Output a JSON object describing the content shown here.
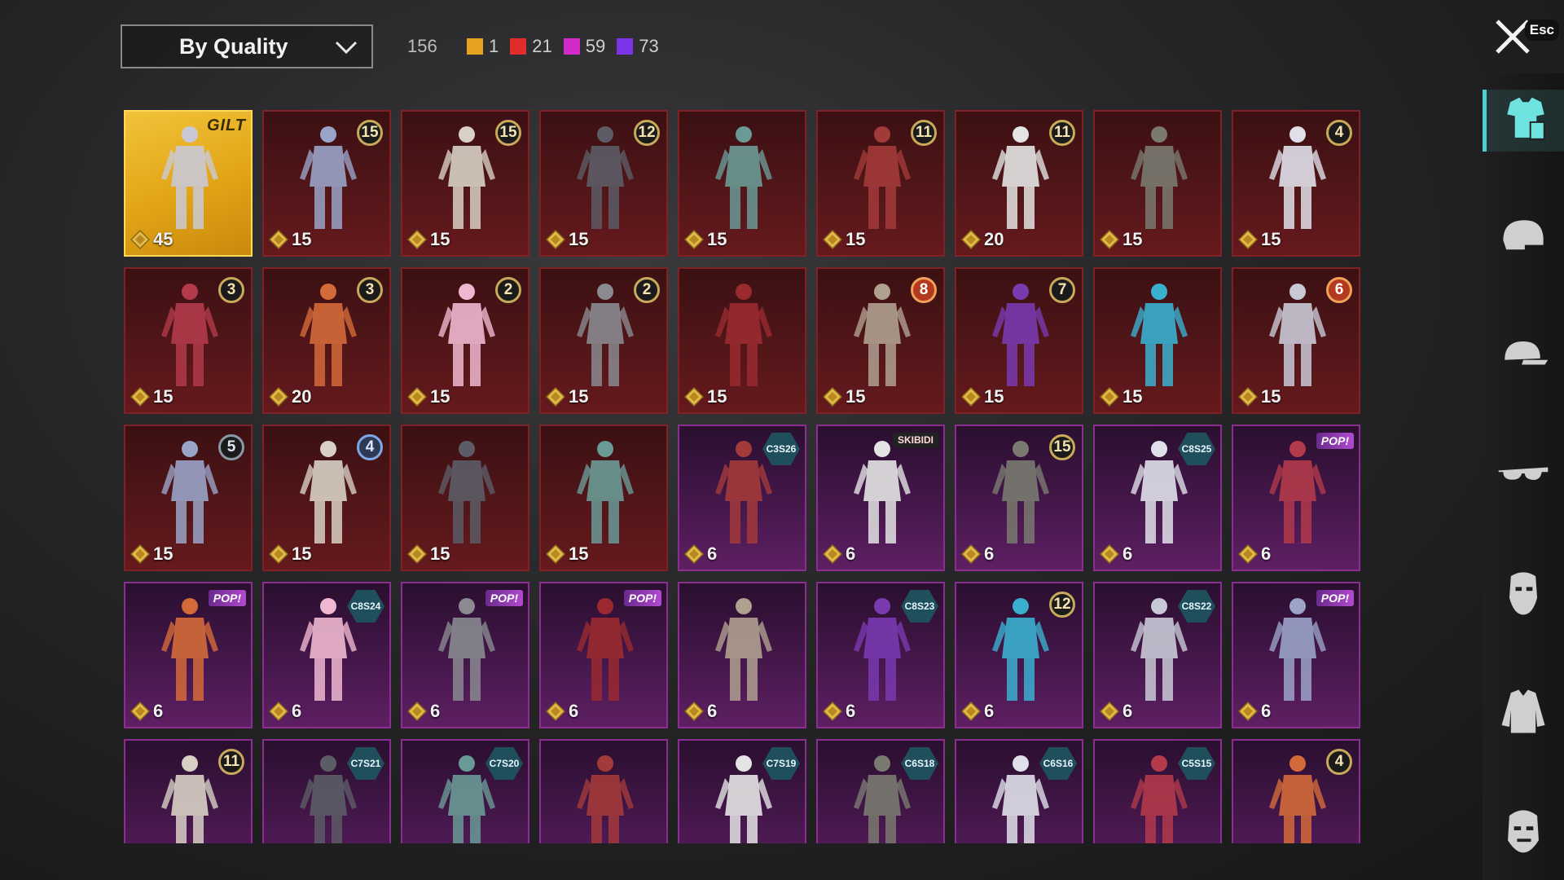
{
  "header": {
    "sort_label": "By Quality",
    "total": "156",
    "legend": [
      {
        "color": "#e6a21e",
        "count": "1"
      },
      {
        "color": "#e22b2b",
        "count": "21"
      },
      {
        "color": "#d22bc8",
        "count": "59"
      },
      {
        "color": "#7b35e6",
        "count": "73"
      }
    ],
    "close_label": "Esc"
  },
  "sidebar": {
    "items": [
      {
        "icon": "outfit-icon",
        "active": true
      },
      {
        "icon": "helmet-icon",
        "active": false
      },
      {
        "icon": "cap-icon",
        "active": false
      },
      {
        "icon": "glasses-icon",
        "active": false
      },
      {
        "icon": "mask-icon",
        "active": false
      },
      {
        "icon": "jacket-icon",
        "active": false
      },
      {
        "icon": "face-icon",
        "active": false
      }
    ]
  },
  "items": [
    {
      "tier": "gold",
      "cost": "45",
      "badge": {
        "type": "logo",
        "text": "GILT"
      }
    },
    {
      "tier": "red",
      "cost": "15",
      "badge": {
        "type": "num",
        "text": "15"
      }
    },
    {
      "tier": "red",
      "cost": "15",
      "badge": {
        "type": "num",
        "text": "15"
      }
    },
    {
      "tier": "red",
      "cost": "15",
      "badge": {
        "type": "num",
        "text": "12"
      }
    },
    {
      "tier": "red",
      "cost": "15",
      "badge": null
    },
    {
      "tier": "red",
      "cost": "15",
      "badge": {
        "type": "num",
        "text": "11"
      }
    },
    {
      "tier": "red",
      "cost": "20",
      "badge": {
        "type": "num",
        "text": "11"
      }
    },
    {
      "tier": "red",
      "cost": "15",
      "badge": null
    },
    {
      "tier": "red",
      "cost": "15",
      "badge": {
        "type": "num",
        "text": "4"
      }
    },
    {
      "tier": "red",
      "cost": "15",
      "badge": {
        "type": "num",
        "text": "3"
      }
    },
    {
      "tier": "red",
      "cost": "20",
      "badge": {
        "type": "num",
        "text": "3"
      }
    },
    {
      "tier": "red",
      "cost": "15",
      "badge": {
        "type": "num",
        "text": "2"
      }
    },
    {
      "tier": "red",
      "cost": "15",
      "badge": {
        "type": "num",
        "text": "2"
      }
    },
    {
      "tier": "red",
      "cost": "15",
      "badge": null
    },
    {
      "tier": "red",
      "cost": "15",
      "badge": {
        "type": "num",
        "text": "8",
        "style": "orange"
      }
    },
    {
      "tier": "red",
      "cost": "15",
      "badge": {
        "type": "num",
        "text": "7"
      }
    },
    {
      "tier": "red",
      "cost": "15",
      "badge": null
    },
    {
      "tier": "red",
      "cost": "15",
      "badge": {
        "type": "num",
        "text": "6",
        "style": "orange"
      }
    },
    {
      "tier": "red",
      "cost": "15",
      "badge": {
        "type": "num",
        "text": "5",
        "style": "grey"
      }
    },
    {
      "tier": "red",
      "cost": "15",
      "badge": {
        "type": "num",
        "text": "4",
        "style": "blue"
      }
    },
    {
      "tier": "red",
      "cost": "15",
      "badge": null
    },
    {
      "tier": "red",
      "cost": "15",
      "badge": null
    },
    {
      "tier": "purple",
      "cost": "6",
      "badge": {
        "type": "season",
        "text": "C3S26"
      }
    },
    {
      "tier": "purple",
      "cost": "6",
      "badge": {
        "type": "tag-dark",
        "text": "SKIBIDI"
      }
    },
    {
      "tier": "purple",
      "cost": "6",
      "badge": {
        "type": "num",
        "text": "15"
      }
    },
    {
      "tier": "purple",
      "cost": "6",
      "badge": {
        "type": "season",
        "text": "C8S25"
      }
    },
    {
      "tier": "purple",
      "cost": "6",
      "badge": {
        "type": "tag",
        "text": "POP!"
      }
    },
    {
      "tier": "purple",
      "cost": "6",
      "badge": {
        "type": "tag",
        "text": "POP!"
      }
    },
    {
      "tier": "purple",
      "cost": "6",
      "badge": {
        "type": "season",
        "text": "C8S24"
      }
    },
    {
      "tier": "purple",
      "cost": "6",
      "badge": {
        "type": "tag",
        "text": "POP!"
      }
    },
    {
      "tier": "purple",
      "cost": "6",
      "badge": {
        "type": "tag",
        "text": "POP!"
      }
    },
    {
      "tier": "purple",
      "cost": "6",
      "badge": null
    },
    {
      "tier": "purple",
      "cost": "6",
      "badge": {
        "type": "season",
        "text": "C8S23"
      }
    },
    {
      "tier": "purple",
      "cost": "6",
      "badge": {
        "type": "num",
        "text": "12"
      }
    },
    {
      "tier": "purple",
      "cost": "6",
      "badge": {
        "type": "season",
        "text": "C8S22"
      }
    },
    {
      "tier": "purple",
      "cost": "6",
      "badge": {
        "type": "tag",
        "text": "POP!"
      }
    },
    {
      "tier": "purple",
      "cost": "",
      "badge": {
        "type": "num",
        "text": "11"
      }
    },
    {
      "tier": "purple",
      "cost": "",
      "badge": {
        "type": "season",
        "text": "C7S21"
      }
    },
    {
      "tier": "purple",
      "cost": "",
      "badge": {
        "type": "season",
        "text": "C7S20"
      }
    },
    {
      "tier": "purple",
      "cost": "",
      "badge": null
    },
    {
      "tier": "purple",
      "cost": "",
      "badge": {
        "type": "season",
        "text": "C7S19"
      }
    },
    {
      "tier": "purple",
      "cost": "",
      "badge": {
        "type": "season",
        "text": "C6S18"
      }
    },
    {
      "tier": "purple",
      "cost": "",
      "badge": {
        "type": "season",
        "text": "C6S16"
      }
    },
    {
      "tier": "purple",
      "cost": "",
      "badge": {
        "type": "season",
        "text": "C5S15"
      }
    },
    {
      "tier": "purple",
      "cost": "",
      "badge": {
        "type": "num",
        "text": "4"
      }
    }
  ]
}
